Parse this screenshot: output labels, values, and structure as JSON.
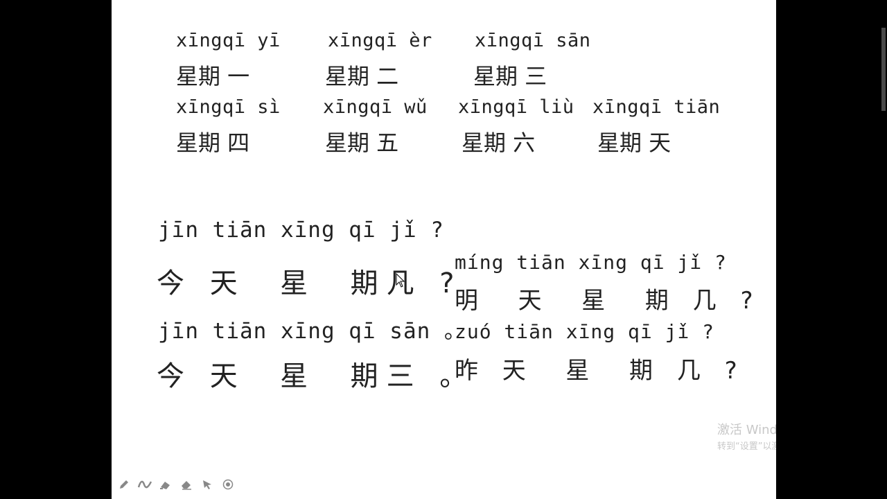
{
  "weekdays": [
    {
      "pinyin": "xīngqī yī",
      "hanzi": "星期 一"
    },
    {
      "pinyin": "xīngqī èr",
      "hanzi": "星期 二"
    },
    {
      "pinyin": "xīngqī sān",
      "hanzi": "星期 三"
    },
    {
      "pinyin": "xīngqī sì",
      "hanzi": "星期 四"
    },
    {
      "pinyin": "xīngqī wǔ",
      "hanzi": "星期 五"
    },
    {
      "pinyin": "xīngqī liù",
      "hanzi": "星期 六"
    },
    {
      "pinyin": "xīngqī tiān",
      "hanzi": "星期 天"
    }
  ],
  "left_dialog": [
    {
      "pinyin": "jīn tiān xīng qī jǐ ?",
      "hanzi": "今 天  星  期几 ?"
    },
    {
      "pinyin": "jīn tiān xīng qī sān 。",
      "hanzi": "今 天  星  期三 。"
    }
  ],
  "right_dialog": [
    {
      "pinyin": "míng tiān xīng qī jǐ ?",
      "hanzi": "明  天  星  期 几 ?"
    },
    {
      "pinyin": "zuó tiān xīng qī jǐ ?",
      "hanzi": "昨 天  星  期 几 ?"
    }
  ],
  "watermark": {
    "title": "激活 Windows",
    "subtitle": "转到“设置”以激活 Windows。"
  },
  "toolbar": {
    "icons": [
      "pen-icon",
      "squiggle-icon",
      "highlighter-icon",
      "eraser-icon",
      "pointer-icon",
      "record-icon"
    ]
  }
}
